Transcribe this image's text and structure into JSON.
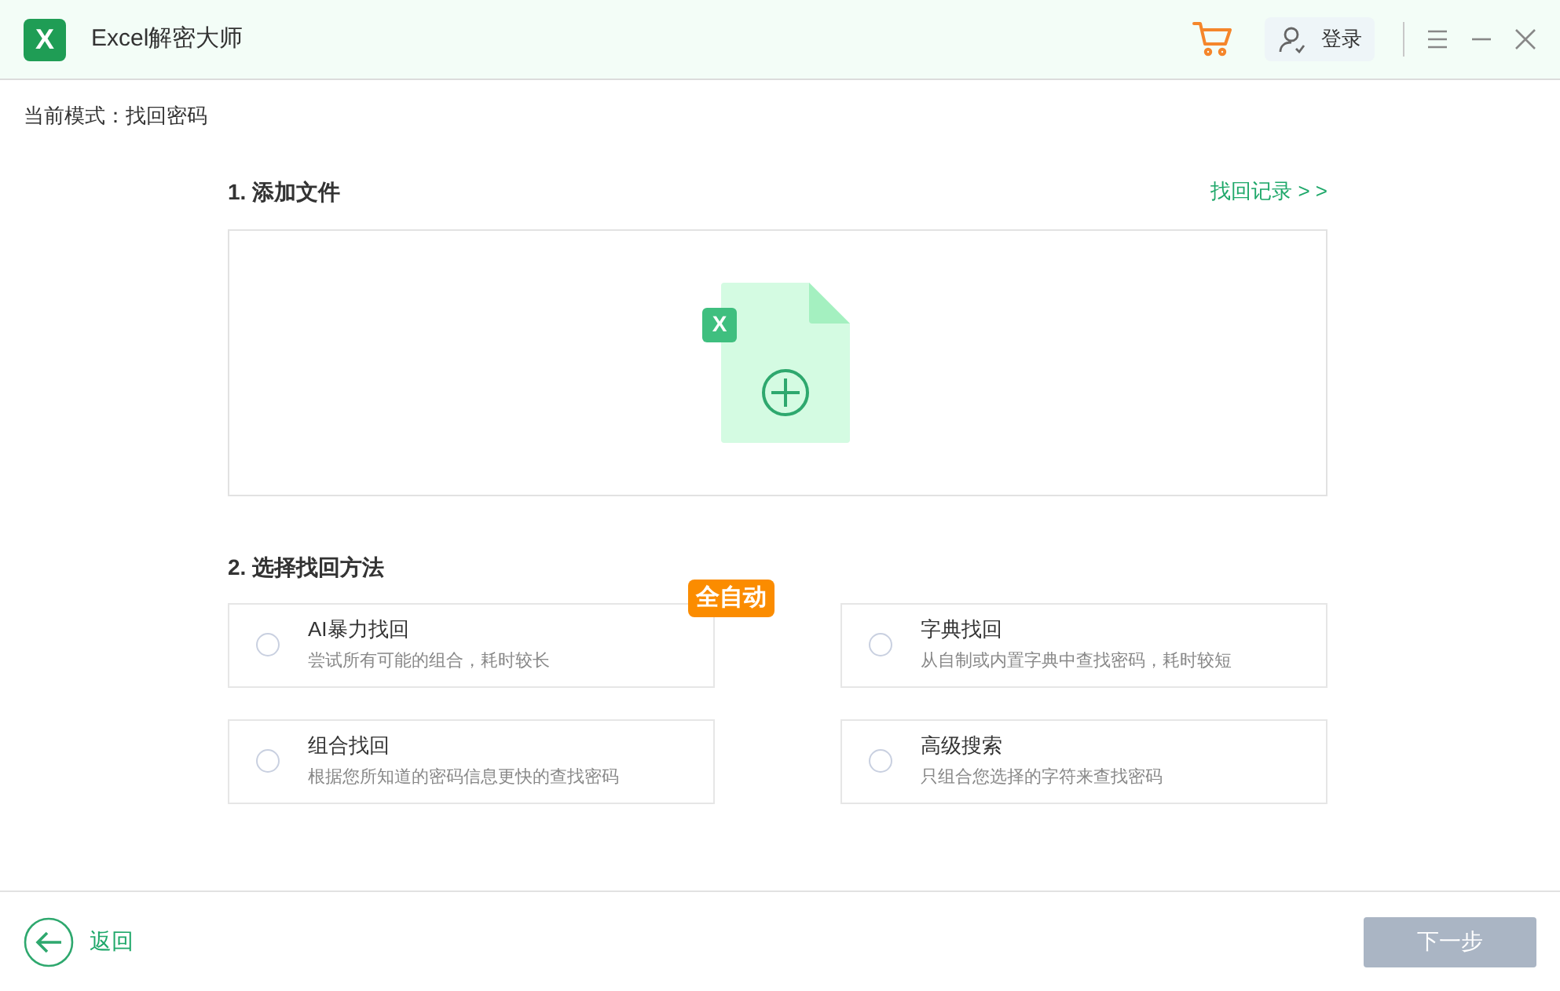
{
  "window": {
    "logo_letter": "X",
    "title": "Excel解密大师",
    "login": "登录"
  },
  "mode": "当前模式：找回密码",
  "step1": {
    "title": "1. 添加文件",
    "history_link": "找回记录 > >",
    "file_badge": "X"
  },
  "step2": {
    "title": "2. 选择找回方法",
    "methods": [
      {
        "name": "AI暴力找回",
        "description": "尝试所有可能的组合，耗时较长",
        "selected": false,
        "badge": "全自动"
      },
      {
        "name": "字典找回",
        "description": "从自制或内置字典中查找密码，耗时较短",
        "selected": false
      },
      {
        "name": "组合找回",
        "description": "根据您所知道的密码信息更快的查找密码",
        "selected": false
      },
      {
        "name": "高级搜索",
        "description": "只组合您选择的字符来查找密码",
        "selected": false
      }
    ]
  },
  "footer": {
    "back": "返回",
    "next": {
      "label": "下一步",
      "disabled": true
    }
  }
}
